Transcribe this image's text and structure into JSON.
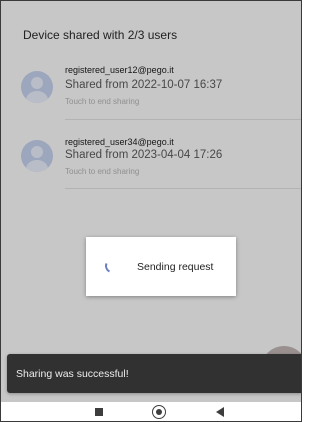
{
  "header": {
    "title": "Device shared with 2/3 users"
  },
  "users": [
    {
      "email": "registered_user12@pego.it",
      "shared": "Shared from 2022-10-07 16:37",
      "hint": "Touch to end sharing"
    },
    {
      "email": "registered_user34@pego.it",
      "shared": "Shared from 2023-04-04 17:26",
      "hint": "Touch to end sharing"
    }
  ],
  "dialog": {
    "text": "Sending request"
  },
  "snackbar": {
    "text": "Sharing was successful!"
  },
  "icons": {
    "avatar": "person-icon",
    "spinner": "loading-spinner-icon",
    "nav": [
      "recents-square-icon",
      "home-circle-icon",
      "back-triangle-icon"
    ]
  },
  "colors": {
    "avatar_bg": "#c8d5f2",
    "snackbar_bg": "#313131",
    "spinner": "#6c7fc2"
  }
}
